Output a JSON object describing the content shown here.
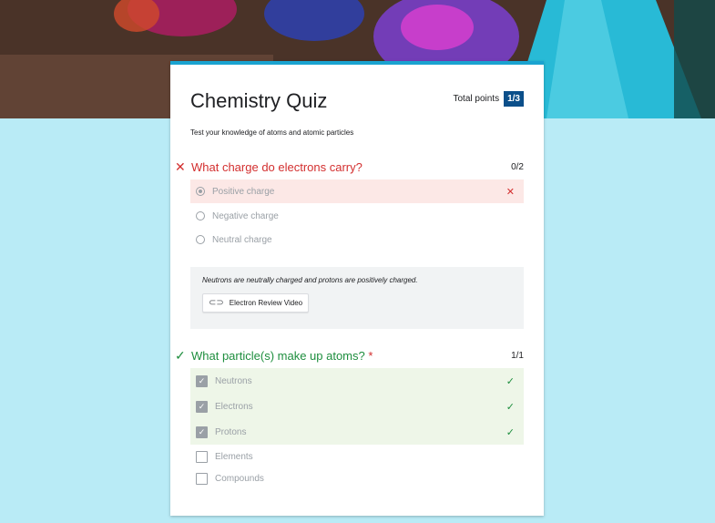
{
  "quiz": {
    "title": "Chemistry Quiz",
    "total_points_label": "Total points",
    "total_points_value": "1/3",
    "description": "Test your knowledge of atoms and atomic particles"
  },
  "questions": [
    {
      "title": "What charge do electrons carry?",
      "score": "0/2",
      "status": "incorrect",
      "status_icon": "x-icon",
      "options": [
        "Positive charge",
        "Negative charge",
        "Neutral charge"
      ],
      "selected": "Positive charge",
      "feedback": {
        "text": "Neutrons are neutrally charged and protons are positively charged.",
        "link_label": "Electron Review Video",
        "link_icon": "link-icon"
      }
    },
    {
      "title": "What particle(s) make up atoms?",
      "required_mark": "*",
      "score": "1/1",
      "status": "correct",
      "status_icon": "check-icon",
      "options": [
        "Neutrons",
        "Electrons",
        "Protons",
        "Elements",
        "Compounds"
      ],
      "selected": [
        "Neutrons",
        "Electrons",
        "Protons"
      ]
    }
  ],
  "colors": {
    "background": "#b9ebf6",
    "card_accent": "#1aa3d0",
    "points_badge": "#0b4f8a",
    "incorrect": "#d32f2f",
    "correct": "#1e8e3e",
    "incorrect_bg": "#fce8e6",
    "correct_bg": "#eef6e8"
  }
}
